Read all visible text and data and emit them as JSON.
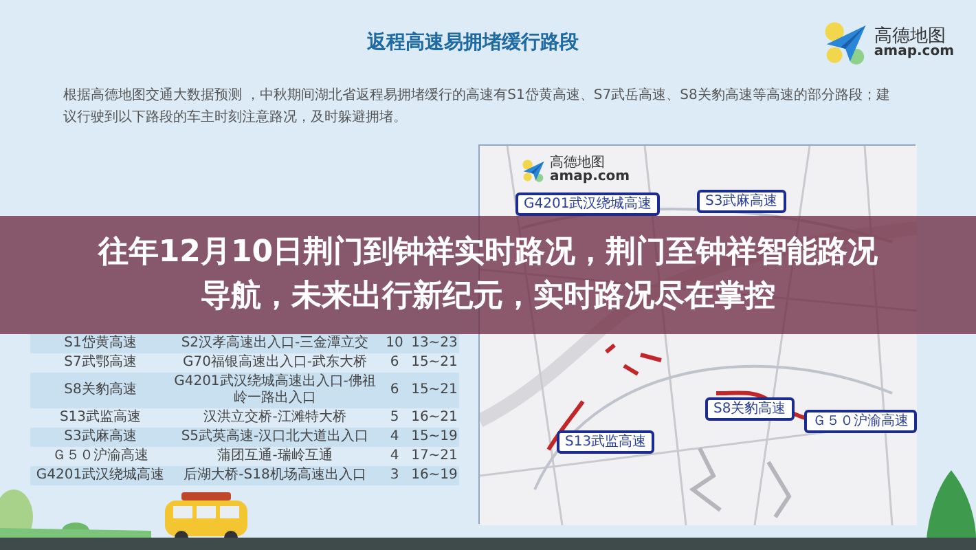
{
  "header": {
    "title": "返程高速易拥堵缓行路段",
    "logo": {
      "name": "高德地图",
      "domain": "amap.com"
    }
  },
  "intro": "根据高德地图交通大数据预测 ，中秋期间湖北省返程易拥堵缓行的高速有S1岱黄高速、S7武岳高速、S8关豹高速等高速的部分路段；建议行驶到以下路段的车主时刻注意路况，及时躲避拥堵。",
  "table": {
    "rows": [
      {
        "road": "S1岱黄高速",
        "section": "S2汉孝高速出入口-三金潭立交",
        "column_3": "10",
        "column_4": "13~23"
      },
      {
        "road": "S7武鄂高速",
        "section": "G70福银高速出入口-武东大桥",
        "column_3": "6",
        "column_4": "15~21"
      },
      {
        "road": "S8关豹高速",
        "section": "G4201武汉绕城高速出入口-佛祖岭一路出入口",
        "column_3": "6",
        "column_4": "15~21"
      },
      {
        "road": "S13武监高速",
        "section": "汉洪立交桥-江滩特大桥",
        "column_3": "5",
        "column_4": "16~21"
      },
      {
        "road": "S3武麻高速",
        "section": "S5武英高速-汉口北大道出入口",
        "column_3": "4",
        "column_4": "15~19"
      },
      {
        "road": "Ｇ５０沪渝高速",
        "section": "蒲团互通-瑞岭互通",
        "column_3": "4",
        "column_4": "17~21"
      },
      {
        "road": "G4201武汉绕城高速",
        "section": "后湖大桥-S18机场高速出入口",
        "column_3": "3",
        "column_4": "16~19"
      }
    ]
  },
  "map": {
    "logo": {
      "name": "高德地图",
      "domain": "amap.com"
    },
    "route_labels": [
      "G4201武汉绕城高速",
      "S3武麻高速",
      "S8关豹高速",
      "Ｇ５０沪渝高速",
      "S13武监高速"
    ]
  },
  "headline": [
    "往年12月10日荆门到钟祥实时路况，荆门至钟祥智能路况",
    "导航，未来出行新纪元，实时路况尽在掌控"
  ]
}
